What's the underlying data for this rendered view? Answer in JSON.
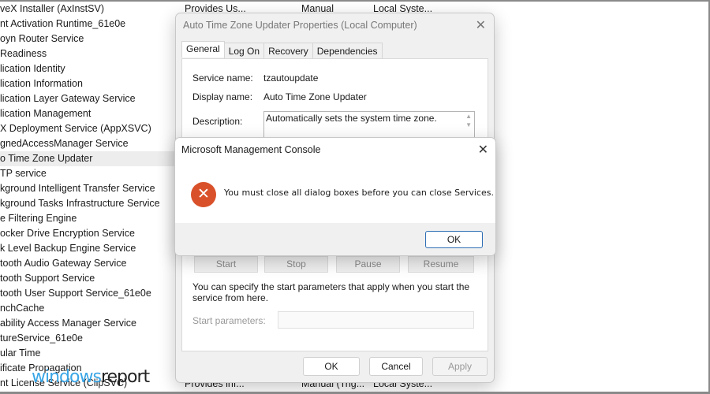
{
  "services": {
    "rows": [
      "veX Installer (AxInstSV)",
      "nt Activation Runtime_61e0e",
      "oyn Router Service",
      " Readiness",
      "lication Identity",
      "lication Information",
      "lication Layer Gateway Service",
      "lication Management",
      "X Deployment Service (AppXSVC)",
      "gnedAccessManager Service",
      "o Time Zone Updater",
      "TP service",
      "kground Intelligent Transfer Service",
      "kground Tasks Infrastructure Service",
      "e Filtering Engine",
      "ocker Drive Encryption Service",
      "k Level Backup Engine Service",
      "tooth Audio Gateway Service",
      "tooth Support Service",
      "tooth User Support Service_61e0e",
      "nchCache",
      "ability Access Manager Service",
      "tureService_61e0e",
      "ular Time",
      "ificate Propagation",
      "nt License Service (ClipSVC)"
    ],
    "selected_index": 10,
    "top_row": {
      "description": "Provides Us...",
      "startup": "Manual",
      "logon": "Local Syste..."
    },
    "bottom_row": {
      "description": "Provides inf...",
      "startup": "Manual (Trig...",
      "logon": "Local Syste..."
    }
  },
  "properties": {
    "title": "Auto Time Zone Updater Properties (Local Computer)",
    "tabs": [
      "General",
      "Log On",
      "Recovery",
      "Dependencies"
    ],
    "active_tab": "General",
    "service_name_label": "Service name:",
    "service_name": "tzautoupdate",
    "display_name_label": "Display name:",
    "display_name": "Auto Time Zone Updater",
    "description_label": "Description:",
    "description": "Automatically sets the system time zone.",
    "control_buttons": [
      "Start",
      "Stop",
      "Pause",
      "Resume"
    ],
    "hint": "You can specify the start parameters that apply when you start the service from here.",
    "start_params_label": "Start parameters:",
    "start_params_value": "",
    "ok": "OK",
    "cancel": "Cancel",
    "apply": "Apply"
  },
  "mmc": {
    "title": "Microsoft Management Console",
    "message": "You must close all dialog boxes before you can close Services.",
    "ok": "OK",
    "icon": "error-icon",
    "icon_color": "#d9512a"
  },
  "watermark": {
    "part1": "windows",
    "part2": "report"
  }
}
